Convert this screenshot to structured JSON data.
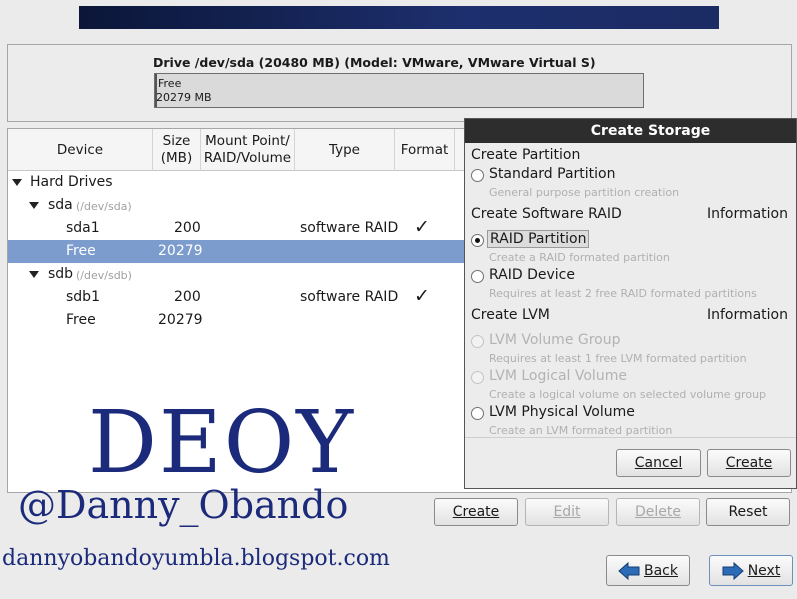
{
  "drive": {
    "title": "Drive /dev/sda (20480 MB) (Model: VMware, VMware Virtual S)",
    "bar_line1": "Free",
    "bar_line2": "20279 MB"
  },
  "table": {
    "headers": [
      "Device",
      "Size\n(MB)",
      "Mount Point/\nRAID/Volume",
      "Type",
      "Format"
    ],
    "group": "Hard Drives",
    "disks": [
      {
        "name": "sda",
        "path": "(/dev/sda)",
        "rows": [
          {
            "device": "sda1",
            "size": "200",
            "type": "software RAID",
            "format": "✓"
          },
          {
            "device": "Free",
            "size": "20279",
            "type": "",
            "format": ""
          }
        ]
      },
      {
        "name": "sdb",
        "path": "(/dev/sdb)",
        "rows": [
          {
            "device": "sdb1",
            "size": "200",
            "type": "software RAID",
            "format": "✓"
          },
          {
            "device": "Free",
            "size": "20279",
            "type": "",
            "format": ""
          }
        ]
      }
    ]
  },
  "watermark": {
    "big": "DEOY",
    "handle": "@Danny_Obando",
    "site": "dannyobandoyumbla.blogspot.com"
  },
  "actions": {
    "create": "Create",
    "edit": "Edit",
    "delete": "Delete",
    "reset": "Reset"
  },
  "nav": {
    "back": "Back",
    "next": "Next"
  },
  "dialog": {
    "title": "Create Storage",
    "section_partition": "Create Partition",
    "standard_partition": "Standard Partition",
    "standard_partition_desc": "General purpose partition creation",
    "section_raid": "Create Software RAID",
    "info_raid": "Information",
    "raid_partition": "RAID Partition",
    "raid_partition_desc": "Create a RAID formated partition",
    "raid_device": "RAID Device",
    "raid_device_desc": "Requires at least 2 free RAID formated partitions",
    "section_lvm": "Create LVM",
    "info_lvm": "Information",
    "lvm_volume_group": "LVM Volume Group",
    "lvm_volume_group_desc": "Requires at least 1 free LVM formated partition",
    "lvm_logical_volume": "LVM Logical Volume",
    "lvm_logical_volume_desc": "Create a logical volume on selected volume group",
    "lvm_physical_volume": "LVM Physical Volume",
    "lvm_physical_volume_desc": "Create an LVM formated partition",
    "cancel": "Cancel",
    "create": "Create"
  },
  "colors": {
    "selection": "#7b9ccc",
    "watermark": "#1b2a7a",
    "banner": "#1d2f6e"
  }
}
